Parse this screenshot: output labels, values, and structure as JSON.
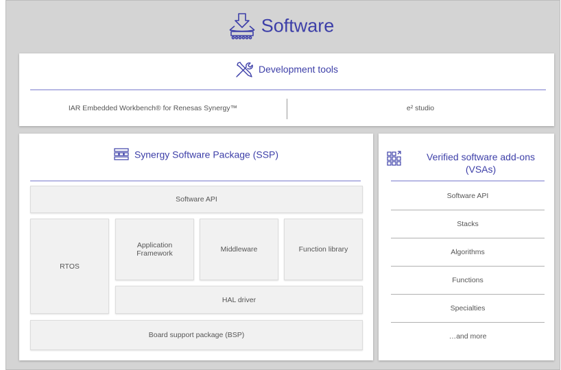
{
  "title": "Software",
  "dev_tools": {
    "heading": "Development tools",
    "left": "IAR Embedded Workbench® for Renesas Synergy™",
    "right": "e² studio"
  },
  "ssp": {
    "heading": "Synergy Software Package (SSP)",
    "software_api": "Software API",
    "rtos": "RTOS",
    "app_framework": "Application Framework",
    "middleware": "Middleware",
    "function_library": "Function library",
    "hal_driver": "HAL driver",
    "bsp": "Board support package (BSP)"
  },
  "vsa": {
    "heading": "Verified software add-ons (VSAs)",
    "items": [
      "Software API",
      "Stacks",
      "Algorithms",
      "Functions",
      "Specialties",
      "…and more"
    ]
  }
}
